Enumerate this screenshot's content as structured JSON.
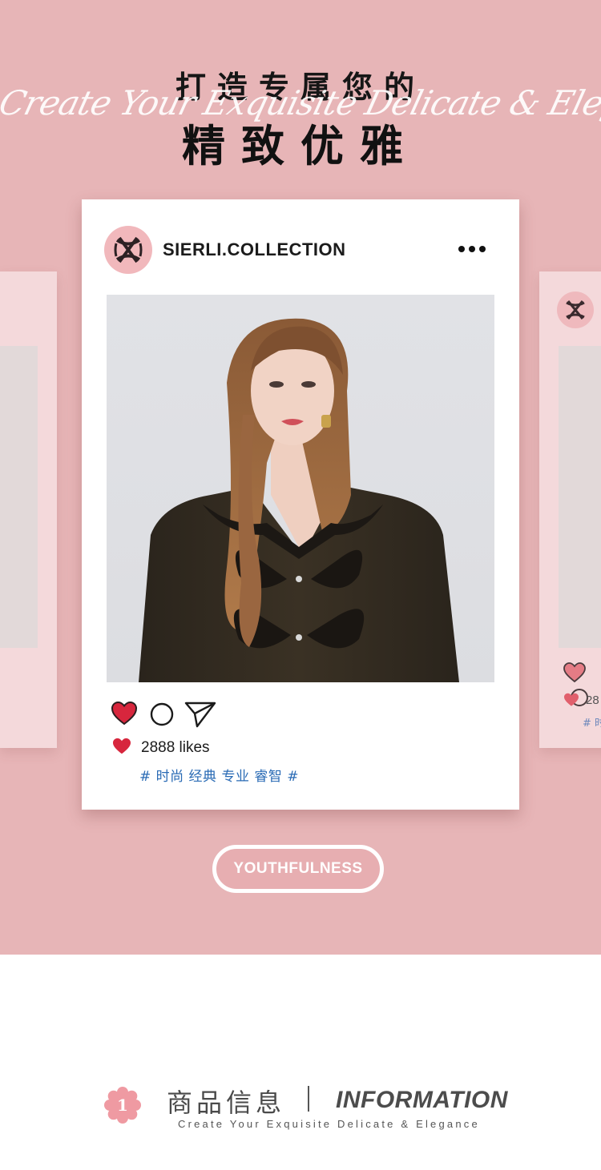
{
  "header": {
    "title_line1": "打造专属您的",
    "script_text": "Create Your Exquisite Delicate & Elegance",
    "title_line2": "精致优雅"
  },
  "post": {
    "username": "SIERLI.COLLECTION",
    "more_icon": "more-dots-icon",
    "likes": "2888 likes",
    "hashtags": "# 时尚 经典 专业 睿智 #",
    "like_color": "#d7263d",
    "hashtag_color": "#2a6bb5"
  },
  "side_right": {
    "likes_partial": "28",
    "hashtag_partial": "# 时"
  },
  "badge": {
    "label": "YOUTHFULNESS"
  },
  "info": {
    "number": "1",
    "title_cn": "商品信息",
    "title_en": "INFORMATION",
    "subtitle": "Create Your Exquisite Delicate & Elegance"
  },
  "colors": {
    "hero_bg": "#e7b5b7",
    "side_card_bg": "#f4d9db",
    "avatar_bg": "#f1b8bc"
  }
}
